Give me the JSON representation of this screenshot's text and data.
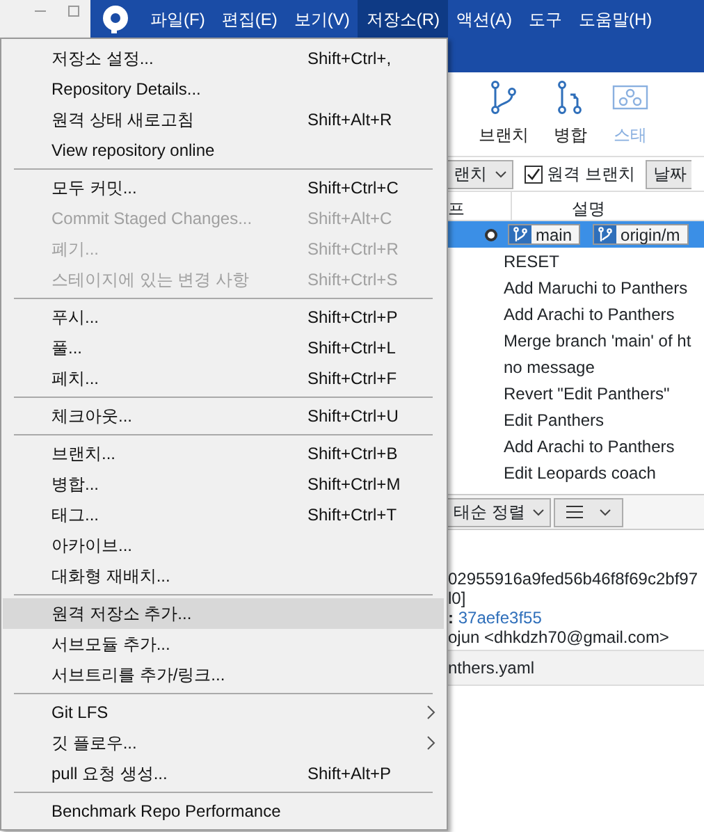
{
  "menubar": [
    {
      "label": "파일(F)",
      "selected": false
    },
    {
      "label": "편집(E)",
      "selected": false
    },
    {
      "label": "보기(V)",
      "selected": false
    },
    {
      "label": "저장소(R)",
      "selected": true
    },
    {
      "label": "액션(A)",
      "selected": false
    },
    {
      "label": "도구",
      "selected": false
    },
    {
      "label": "도움말(H)",
      "selected": false
    }
  ],
  "menu": [
    [
      {
        "label": "저장소 설정...",
        "shortcut": "Shift+Ctrl+,",
        "disabled": false,
        "selected": false
      },
      {
        "label": "Repository Details...",
        "disabled": false,
        "selected": false
      },
      {
        "label": "원격 상태 새로고침",
        "shortcut": "Shift+Alt+R",
        "disabled": false,
        "selected": false
      },
      {
        "label": "View repository online",
        "disabled": false,
        "selected": false
      }
    ],
    [
      {
        "label": "모두 커밋...",
        "shortcut": "Shift+Ctrl+C",
        "disabled": false,
        "selected": false
      },
      {
        "label": "Commit Staged Changes...",
        "shortcut": "Shift+Alt+C",
        "disabled": true,
        "selected": false
      },
      {
        "label": "폐기...",
        "shortcut": "Shift+Ctrl+R",
        "disabled": true,
        "selected": false
      },
      {
        "label": "스테이지에 있는 변경 사항",
        "shortcut": "Shift+Ctrl+S",
        "disabled": true,
        "selected": false
      }
    ],
    [
      {
        "label": "푸시...",
        "shortcut": "Shift+Ctrl+P",
        "disabled": false,
        "selected": false
      },
      {
        "label": "풀...",
        "shortcut": "Shift+Ctrl+L",
        "disabled": false,
        "selected": false
      },
      {
        "label": "페치...",
        "shortcut": "Shift+Ctrl+F",
        "disabled": false,
        "selected": false
      }
    ],
    [
      {
        "label": "체크아웃...",
        "shortcut": "Shift+Ctrl+U",
        "disabled": false,
        "selected": false
      }
    ],
    [
      {
        "label": "브랜치...",
        "shortcut": "Shift+Ctrl+B",
        "disabled": false,
        "selected": false
      },
      {
        "label": "병합...",
        "shortcut": "Shift+Ctrl+M",
        "disabled": false,
        "selected": false
      },
      {
        "label": "태그...",
        "shortcut": "Shift+Ctrl+T",
        "disabled": false,
        "selected": false
      },
      {
        "label": "아카이브...",
        "disabled": false,
        "selected": false
      },
      {
        "label": "대화형 재배치...",
        "disabled": false,
        "selected": false
      }
    ],
    [
      {
        "label": "원격 저장소 추가...",
        "disabled": false,
        "selected": true
      },
      {
        "label": "서브모듈 추가...",
        "disabled": false,
        "selected": false
      },
      {
        "label": "서브트리를 추가/링크...",
        "disabled": false,
        "selected": false
      }
    ],
    [
      {
        "label": "Git LFS",
        "submenu": true,
        "disabled": false,
        "selected": false
      },
      {
        "label": "깃 플로우...",
        "submenu": true,
        "disabled": false,
        "selected": false
      },
      {
        "label": "pull 요청 생성...",
        "shortcut": "Shift+Alt+P",
        "disabled": false,
        "selected": false
      }
    ],
    [
      {
        "label": "Benchmark Repo Performance",
        "disabled": false,
        "selected": false
      }
    ]
  ],
  "toolbar": [
    {
      "label": "브랜치",
      "kind": "branch",
      "disabled": false
    },
    {
      "label": "병합",
      "kind": "merge",
      "disabled": false
    },
    {
      "label": "스태",
      "kind": "stash",
      "disabled": true
    }
  ],
  "filter_bar": {
    "branch_dropdown": "랜치",
    "remote_branches": {
      "label": "원격 브랜치",
      "checked": true
    },
    "sort_dropdown": "날짜"
  },
  "columns": [
    "프",
    "설명"
  ],
  "commits": [
    {
      "branches": [
        "main",
        "origin/m"
      ],
      "selected": true
    },
    {
      "message": "RESET",
      "selected": false
    },
    {
      "message": "Add Maruchi to Panthers",
      "selected": false
    },
    {
      "message": "Add Arachi to Panthers",
      "selected": false
    },
    {
      "message": "Merge branch 'main' of ht",
      "selected": false
    },
    {
      "message": "no message",
      "selected": false
    },
    {
      "message": "Revert \"Edit Panthers\"",
      "selected": false
    },
    {
      "message": "Edit Panthers",
      "selected": false
    },
    {
      "message": "Add Arachi to Panthers",
      "selected": false
    },
    {
      "message": "Edit Leopards coach",
      "selected": false
    }
  ],
  "details_toolbar": {
    "sort_dropdown": "태순 정렬"
  },
  "details": {
    "hash": "02955916a9fed56b46f8f69c2bf97",
    "refs": "l0]",
    "parent_label": ":",
    "parent": "37aefe3f55",
    "author": "ojun <dhkdzh70@gmail.com>"
  },
  "files": [
    "nthers.yaml"
  ]
}
